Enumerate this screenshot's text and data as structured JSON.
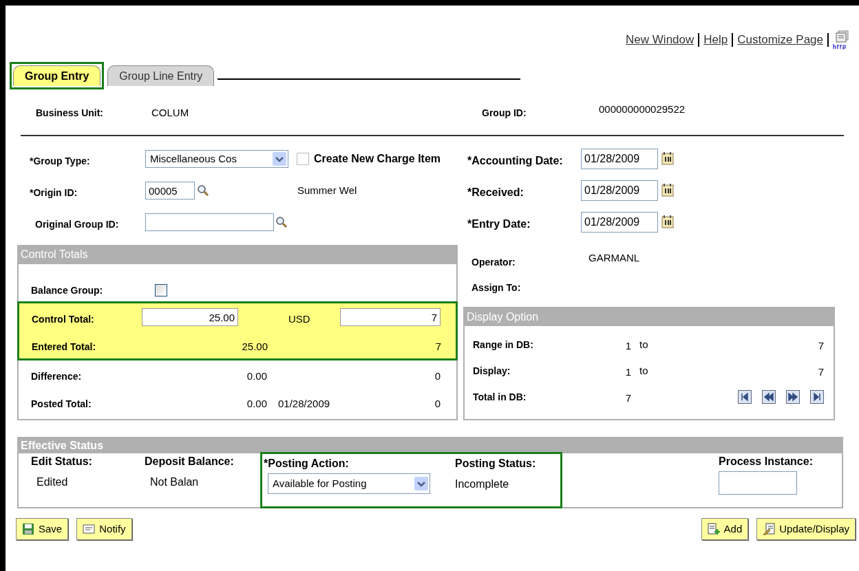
{
  "header_links": [
    {
      "label": "New Window"
    },
    {
      "label": "Help"
    },
    {
      "label": "Customize Page"
    }
  ],
  "tabs": [
    {
      "label": "Group Entry",
      "selected": true,
      "highlighted": true
    },
    {
      "label": "Group Line Entry",
      "selected": false,
      "highlighted": false
    }
  ],
  "business_unit": {
    "label": "Business Unit:",
    "value": "COLUM"
  },
  "group_id": {
    "label": "Group ID:",
    "value": "000000000029522"
  },
  "group_type": {
    "label": "*Group Type:",
    "value": "Miscellaneous Cos"
  },
  "create_new_charge_item": {
    "label": "Create New Charge Item",
    "checked": false
  },
  "origin_id": {
    "label": "*Origin ID:",
    "value": "00005",
    "description": "Summer Wel"
  },
  "original_group_id": {
    "label": "Original Group ID:"
  },
  "dates": [
    {
      "label": "*Accounting Date:",
      "value": "01/28/2009"
    },
    {
      "label": "*Received:",
      "value": "01/28/2009"
    },
    {
      "label": "*Entry Date:",
      "value": "01/28/2009"
    }
  ],
  "operator": {
    "label": "Operator:",
    "value": "GARMANL"
  },
  "assign_to": {
    "label": "Assign To:"
  },
  "control_totals": {
    "title": "Control Totals",
    "balance_group": {
      "label": "Balance Group:",
      "checked": false
    },
    "rows": [
      {
        "kind": "input",
        "label": "Control Total:",
        "amount": "25.00",
        "currency": "USD",
        "count": "7",
        "highlighted": true
      },
      {
        "kind": "text",
        "label": "Entered Total:",
        "amount": "25.00",
        "count": "7",
        "highlighted": true
      },
      {
        "kind": "text",
        "label": "Difference:",
        "amount": "0.00",
        "count": "0",
        "highlighted": false
      },
      {
        "kind": "text",
        "label": "Posted Total:",
        "amount": "0.00",
        "date": "01/28/2009",
        "count": "0",
        "highlighted": false
      }
    ]
  },
  "display_option": {
    "title": "Display Option",
    "rows": [
      {
        "label": "Range in DB:",
        "from": "1",
        "sep": "to",
        "to": "7"
      },
      {
        "label": "Display:",
        "from": "1",
        "sep": "to",
        "to": "7"
      },
      {
        "label": "Total in DB:",
        "from": "7"
      }
    ]
  },
  "effective_status": {
    "title": "Effective Status",
    "fields": [
      {
        "kind": "text",
        "label": "Edit Status:",
        "value": "Edited",
        "highlighted": false
      },
      {
        "kind": "text",
        "label": "Deposit Balance:",
        "value": "Not Balan",
        "highlighted": false
      },
      {
        "kind": "select",
        "label": "*Posting Action:",
        "value": "Available for Posting",
        "highlighted": true
      },
      {
        "kind": "text",
        "label": "Posting Status:",
        "value": "Incomplete",
        "highlighted": true
      },
      {
        "kind": "input",
        "label": "Process Instance:",
        "highlighted": false
      }
    ]
  },
  "buttons_left": [
    {
      "kind": "save",
      "label": "Save"
    },
    {
      "kind": "notify",
      "label": "Notify"
    }
  ],
  "buttons_right": [
    {
      "kind": "add",
      "label": "Add"
    },
    {
      "kind": "update",
      "label": "Update/Display"
    }
  ]
}
